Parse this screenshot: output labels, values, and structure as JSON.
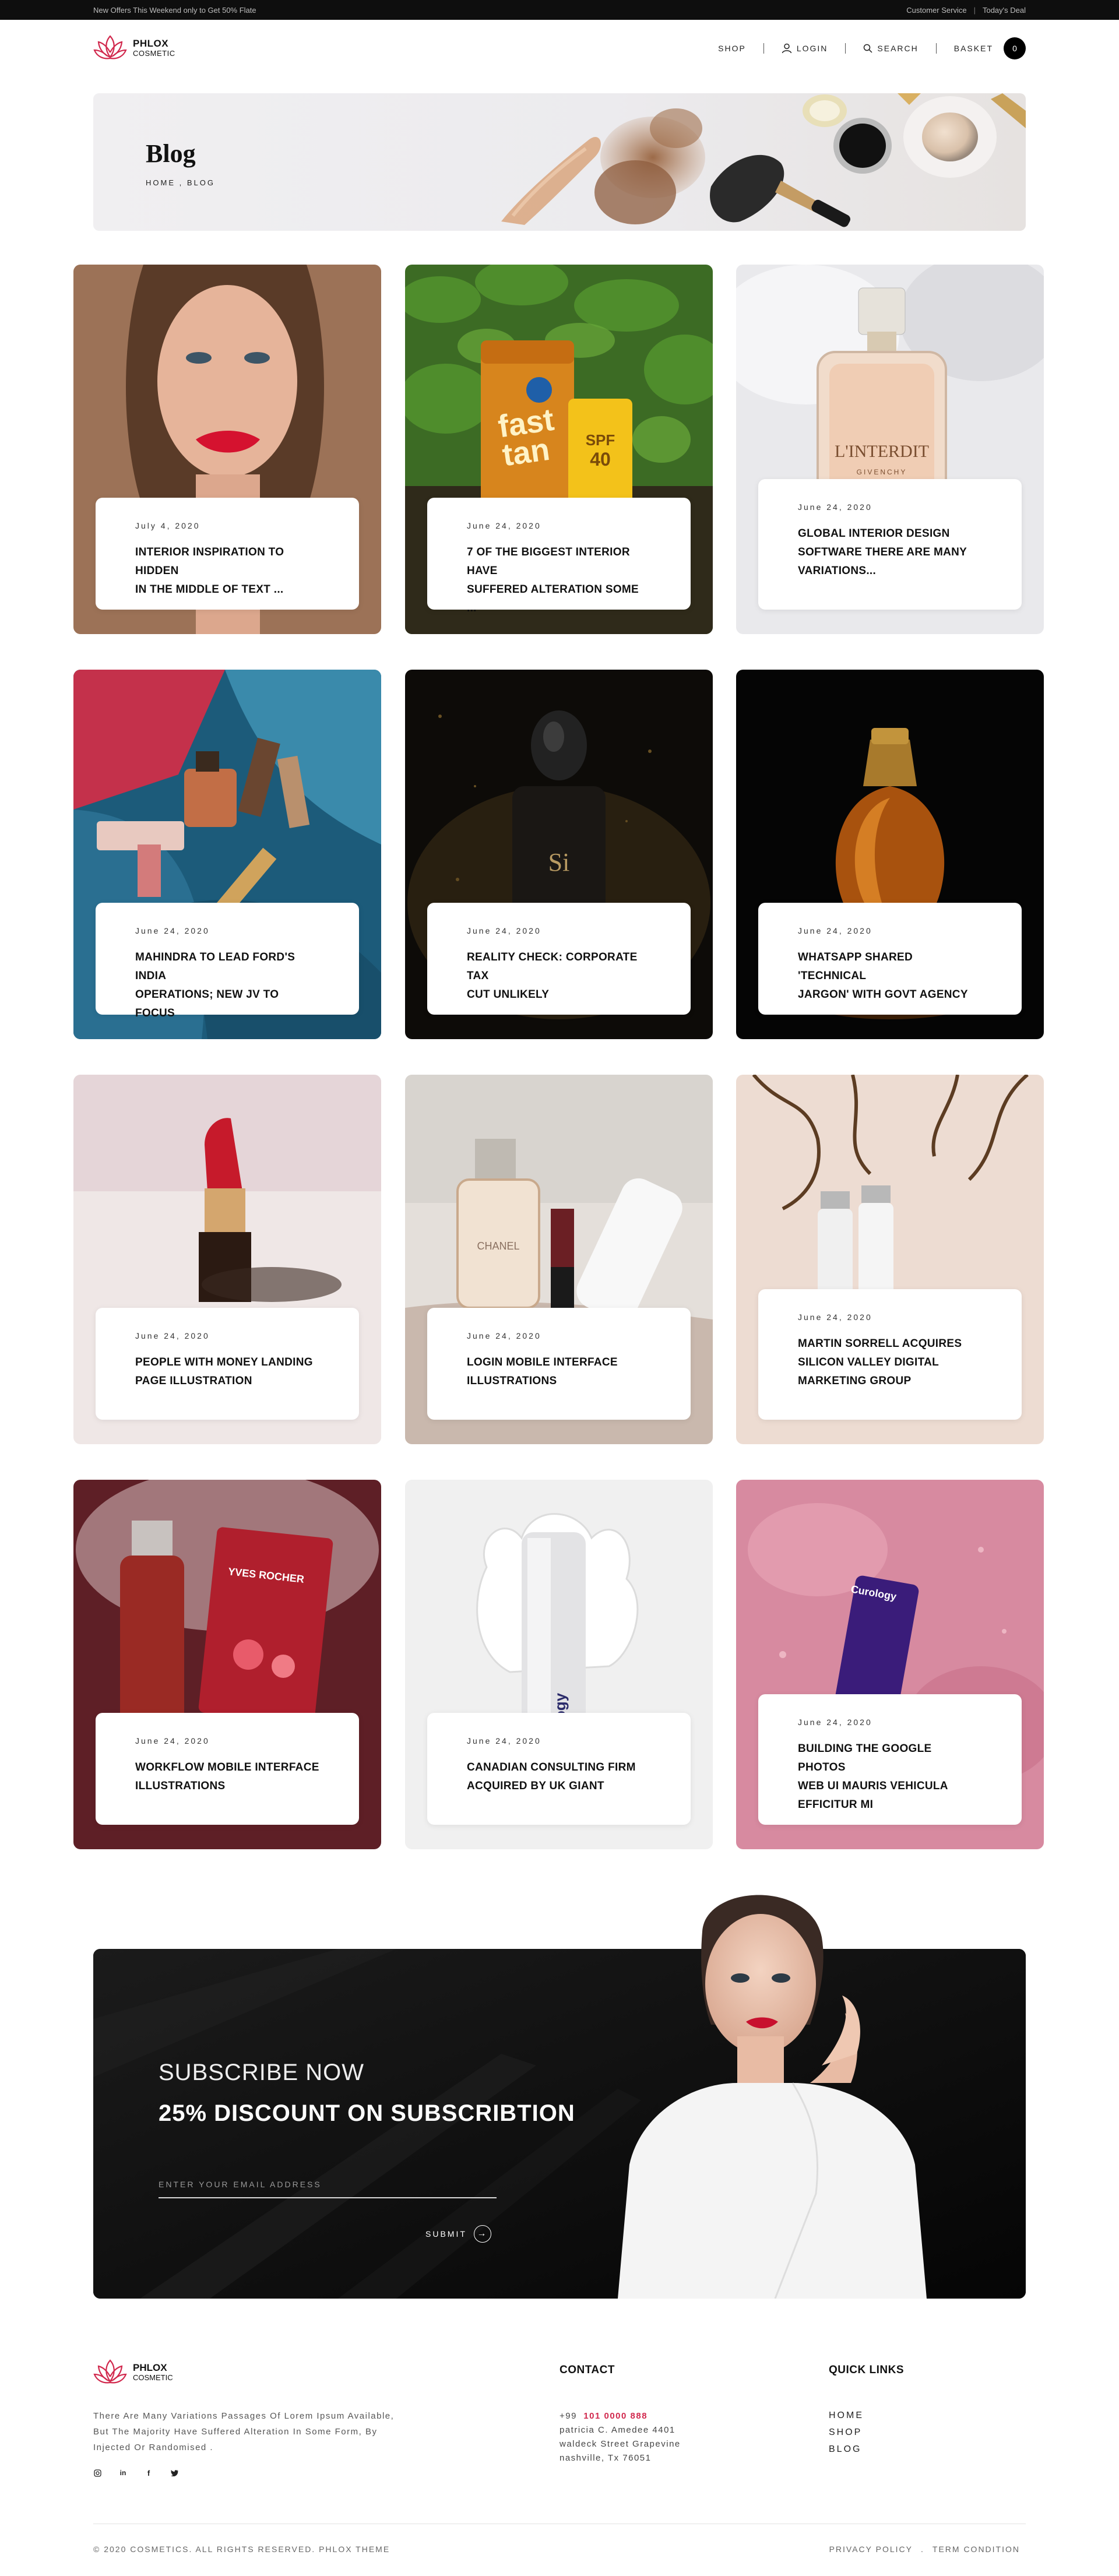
{
  "topbar": {
    "offer": "New Offers This Weekend only to Get 50% Flate",
    "customer_service": "Customer Service",
    "separator": "|",
    "todays_deal": "Today's Deal"
  },
  "brand": {
    "name": "PHLOX",
    "sub": "COSMETIC",
    "accent": "#d1284d"
  },
  "nav": {
    "shop": "SHOP",
    "login": "LOGIN",
    "search": "SEARCH",
    "basket": "BASKET",
    "basket_count": "0"
  },
  "hero": {
    "title": "Blog",
    "breadcrumb": "HOME , BLOG"
  },
  "posts": [
    {
      "date": "July 4, 2020",
      "title": [
        "INTERIOR INSPIRATION TO HIDDEN",
        "IN THE MIDDLE OF TEXT ..."
      ]
    },
    {
      "date": "June 24, 2020",
      "title": [
        "7 OF THE BIGGEST INTERIOR HAVE",
        "SUFFERED ALTERATION SOME ..."
      ]
    },
    {
      "date": "June 24, 2020",
      "title": [
        "GLOBAL INTERIOR DESIGN",
        "SOFTWARE THERE ARE MANY",
        "VARIATIONS..."
      ]
    },
    {
      "date": "June 24, 2020",
      "title": [
        "MAHINDRA TO LEAD FORD'S INDIA",
        "OPERATIONS; NEW JV TO FOCUS"
      ]
    },
    {
      "date": "June 24, 2020",
      "title": [
        "REALITY CHECK: CORPORATE TAX",
        "CUT UNLIKELY"
      ]
    },
    {
      "date": "June 24, 2020",
      "title": [
        "WHATSAPP SHARED 'TECHNICAL",
        "JARGON' WITH GOVT AGENCY"
      ]
    },
    {
      "date": "June 24, 2020",
      "title": [
        "PEOPLE WITH MONEY LANDING",
        "PAGE ILLUSTRATION"
      ]
    },
    {
      "date": "June 24, 2020",
      "title": [
        "LOGIN MOBILE INTERFACE",
        "ILLUSTRATIONS"
      ]
    },
    {
      "date": "June 24, 2020",
      "title": [
        "MARTIN SORRELL ACQUIRES",
        "SILICON VALLEY DIGITAL",
        "MARKETING GROUP"
      ]
    },
    {
      "date": "June 24, 2020",
      "title": [
        "WORKFLOW MOBILE INTERFACE",
        "ILLUSTRATIONS"
      ]
    },
    {
      "date": "June 24, 2020",
      "title": [
        "CANADIAN CONSULTING FIRM",
        "ACQUIRED BY UK GIANT"
      ]
    },
    {
      "date": "June 24, 2020",
      "title": [
        "BUILDING THE GOOGLE PHOTOS",
        "WEB UI MAURIS VEHICULA",
        "EFFICITUR MI"
      ]
    }
  ],
  "subscribe": {
    "kicker": "SUBSCRIBE NOW",
    "headline": "25% DISCOUNT ON SUBSCRIBTION",
    "placeholder": "ENTER YOUR EMAIL ADDRESS",
    "submit": "SUBMIT"
  },
  "footer": {
    "about": [
      "There Are Many Variations Passages Of Lorem Ipsum Available,",
      "But The Majority Have Suffered Alteration In Some Form, By",
      "Injected Or Randomised ."
    ],
    "social_icons": [
      "instagram-icon",
      "linkedin-icon",
      "facebook-icon",
      "twitter-icon"
    ],
    "contact_title": "CONTACT",
    "phone_prefix": "+99",
    "phone_number": "101 0000 888",
    "address": [
      "patricia C. Amedee 4401",
      "waldeck Street Grapevine",
      "nashville, Tx 76051"
    ],
    "links_title": "QUICK LINKS",
    "links": [
      "HOME",
      "SHOP",
      "BLOG"
    ],
    "copyright": "© 2020 COSMETICS. ALL RIGHTS RESERVED. PHLOX THEME",
    "privacy": "PRIVACY POLICY",
    "legal_sep": ".",
    "terms": "TERM CONDITION"
  }
}
